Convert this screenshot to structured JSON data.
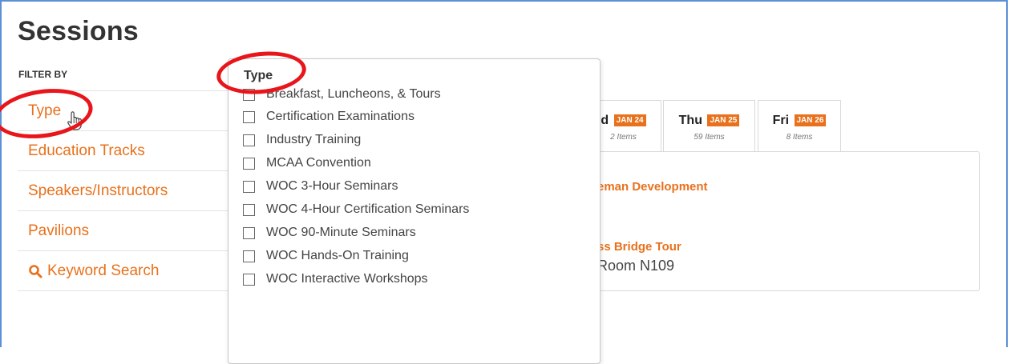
{
  "page": {
    "title": "Sessions",
    "filter_by_label": "FILTER BY"
  },
  "filters": [
    {
      "label": "Type",
      "icon": null
    },
    {
      "label": "Education Tracks",
      "icon": null
    },
    {
      "label": "Speakers/Instructors",
      "icon": null
    },
    {
      "label": "Pavilions",
      "icon": null
    },
    {
      "label": "Keyword Search",
      "icon": "search-icon"
    }
  ],
  "type_dropdown": {
    "title": "Type",
    "options": [
      "Breakfast, Luncheons, & Tours",
      "Certification Examinations",
      "Industry Training",
      "MCAA Convention",
      "WOC 3-Hour Seminars",
      "WOC 4-Hour Certification Seminars",
      "WOC 90-Minute Seminars",
      "WOC Hands-On Training",
      "WOC Interactive Workshops"
    ]
  },
  "day_tabs": [
    {
      "day": "d",
      "date": "JAN 24",
      "count": "2 Items"
    },
    {
      "day": "Thu",
      "date": "JAN 25",
      "count": "59 Items"
    },
    {
      "day": "Fri",
      "date": "JAN 26",
      "count": "8 Items"
    }
  ],
  "sessions": [
    {
      "title": "eman Development"
    },
    {
      "title": "ss Bridge Tour",
      "room": "Room N109"
    }
  ],
  "colors": {
    "accent": "#e8711c",
    "annotation_ring": "#e8151b",
    "frame_border": "#5b8fd6"
  }
}
